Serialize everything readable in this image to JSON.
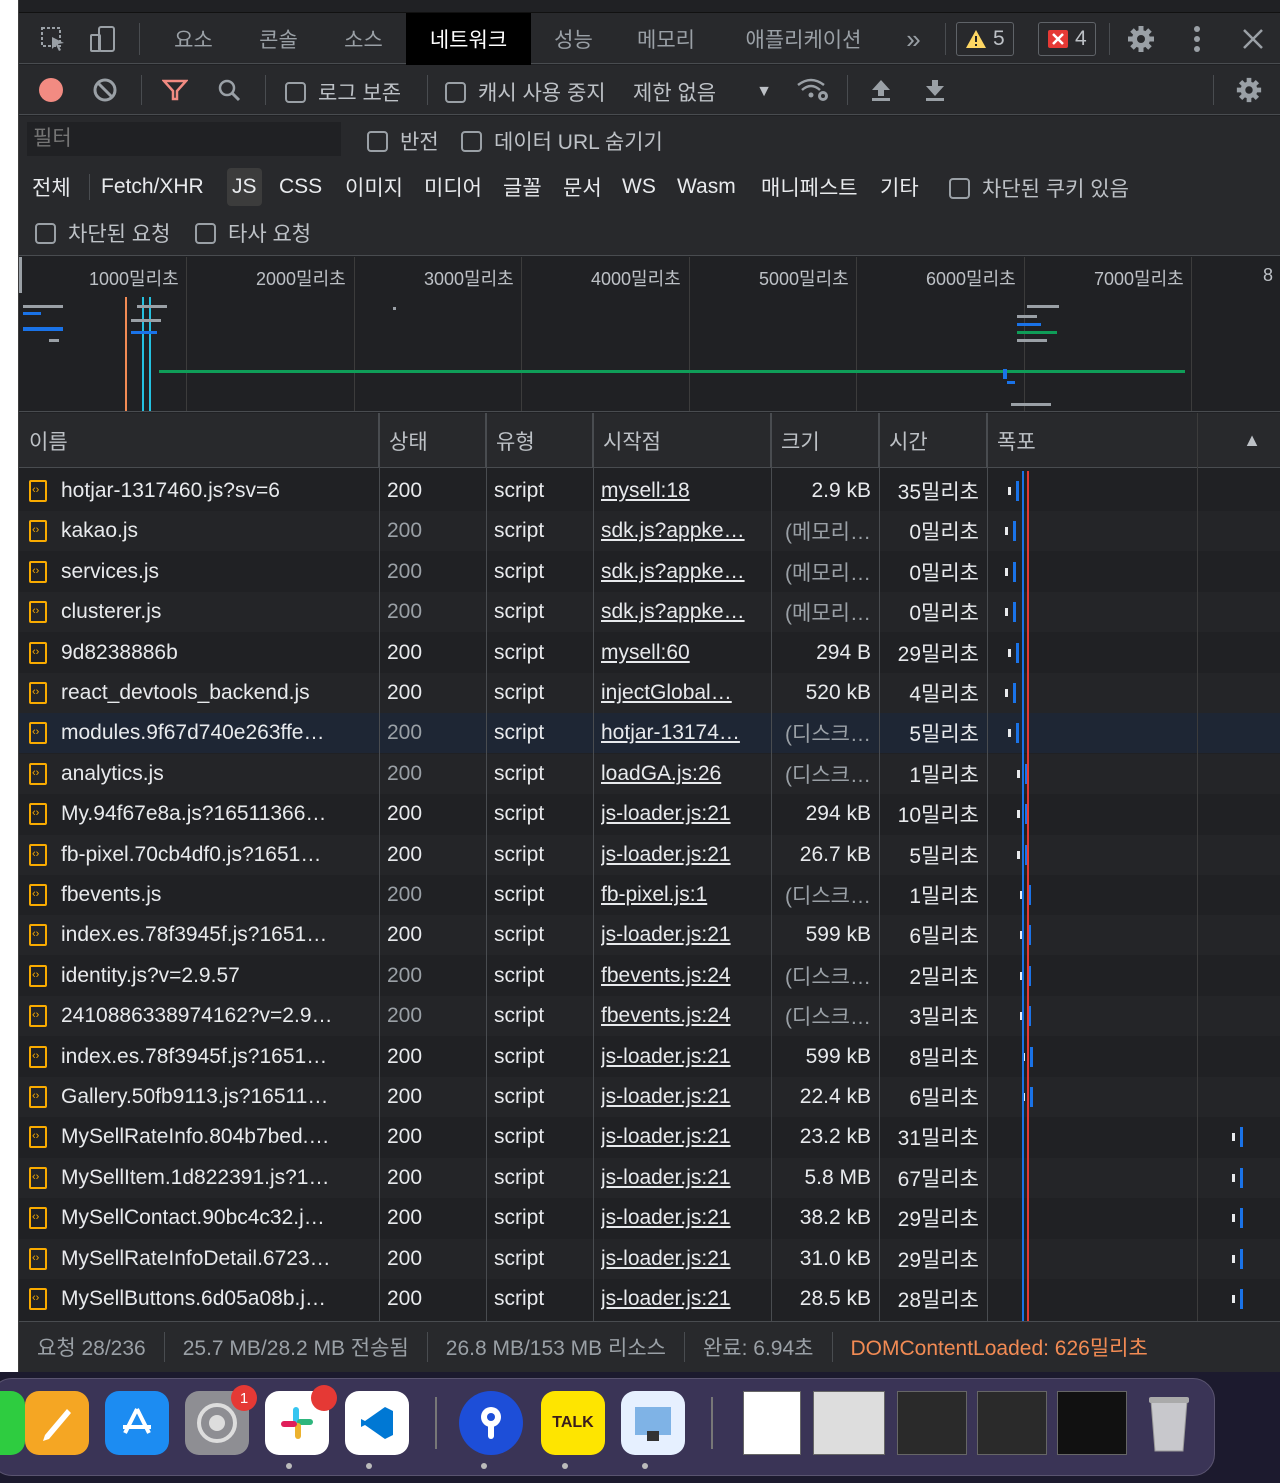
{
  "tabs": {
    "items": [
      "요소",
      "콘솔",
      "소스",
      "네트워크",
      "성능",
      "메모리",
      "애플리케이션"
    ],
    "active": "네트워크",
    "more": "»",
    "warnings": "5",
    "errors": "4"
  },
  "toolbar": {
    "preserve_log": "로그 보존",
    "disable_cache": "캐시 사용 중지",
    "throttling": "제한 없음"
  },
  "filter": {
    "placeholder": "필터",
    "invert": "반전",
    "hide_data_urls": "데이터 URL 숨기기",
    "types": [
      "전체",
      "Fetch/XHR",
      "JS",
      "CSS",
      "이미지",
      "미디어",
      "글꼴",
      "문서",
      "WS",
      "Wasm",
      "매니페스트",
      "기타"
    ],
    "active_type": "JS",
    "blocked_cookies": "차단된 쿠키 있음",
    "blocked_requests": "차단된 요청",
    "third_party": "타사 요청"
  },
  "overview": {
    "ticks": [
      "1000밀리초",
      "2000밀리초",
      "3000밀리초",
      "4000밀리초",
      "5000밀리초",
      "6000밀리초",
      "7000밀리초",
      "8"
    ]
  },
  "columns": [
    "이름",
    "상태",
    "유형",
    "시작점",
    "크기",
    "시간",
    "폭포"
  ],
  "sort_icon": "▲",
  "rows": [
    {
      "name": "hotjar-1317460.js?sv=6",
      "status": "200",
      "type": "script",
      "initiator": "mysell:18",
      "size": "2.9 kB",
      "time": "35밀리초",
      "wf": 0.1,
      "dim": false
    },
    {
      "name": "kakao.js",
      "status": "200",
      "type": "script",
      "initiator": "sdk.js?appke…",
      "size": "(메모리…",
      "time": "0밀리초",
      "wf": 0.09,
      "dim": true
    },
    {
      "name": "services.js",
      "status": "200",
      "type": "script",
      "initiator": "sdk.js?appke…",
      "size": "(메모리…",
      "time": "0밀리초",
      "wf": 0.09,
      "dim": true
    },
    {
      "name": "clusterer.js",
      "status": "200",
      "type": "script",
      "initiator": "sdk.js?appke…",
      "size": "(메모리…",
      "time": "0밀리초",
      "wf": 0.09,
      "dim": true
    },
    {
      "name": "9d8238886b",
      "status": "200",
      "type": "script",
      "initiator": "mysell:60",
      "size": "294 B",
      "time": "29밀리초",
      "wf": 0.1,
      "dim": false
    },
    {
      "name": "react_devtools_backend.js",
      "status": "200",
      "type": "script",
      "initiator": "injectGlobal…",
      "size": "520 kB",
      "time": "4밀리초",
      "wf": 0.09,
      "dim": false
    },
    {
      "name": "modules.9f67d740e263ffe…",
      "status": "200",
      "type": "script",
      "initiator": "hotjar-13174…",
      "size": "(디스크…",
      "time": "5밀리초",
      "wf": 0.1,
      "dim": true
    },
    {
      "name": "analytics.js",
      "status": "200",
      "type": "script",
      "initiator": "loadGA.js:26",
      "size": "(디스크…",
      "time": "1밀리초",
      "wf": 0.13,
      "dim": true
    },
    {
      "name": "My.94f67e8a.js?16511366…",
      "status": "200",
      "type": "script",
      "initiator": "js-loader.js:21",
      "size": "294 kB",
      "time": "10밀리초",
      "wf": 0.13,
      "dim": false
    },
    {
      "name": "fb-pixel.70cb4df0.js?1651…",
      "status": "200",
      "type": "script",
      "initiator": "js-loader.js:21",
      "size": "26.7 kB",
      "time": "5밀리초",
      "wf": 0.13,
      "dim": false
    },
    {
      "name": "fbevents.js",
      "status": "200",
      "type": "script",
      "initiator": "fb-pixel.js:1",
      "size": "(디스크…",
      "time": "1밀리초",
      "wf": 0.14,
      "dim": true
    },
    {
      "name": "index.es.78f3945f.js?1651…",
      "status": "200",
      "type": "script",
      "initiator": "js-loader.js:21",
      "size": "599 kB",
      "time": "6밀리초",
      "wf": 0.14,
      "dim": false
    },
    {
      "name": "identity.js?v=2.9.57",
      "status": "200",
      "type": "script",
      "initiator": "fbevents.js:24",
      "size": "(디스크…",
      "time": "2밀리초",
      "wf": 0.14,
      "dim": true
    },
    {
      "name": "2410886338974162?v=2.9…",
      "status": "200",
      "type": "script",
      "initiator": "fbevents.js:24",
      "size": "(디스크…",
      "time": "3밀리초",
      "wf": 0.14,
      "dim": true
    },
    {
      "name": "index.es.78f3945f.js?1651…",
      "status": "200",
      "type": "script",
      "initiator": "js-loader.js:21",
      "size": "599 kB",
      "time": "8밀리초",
      "wf": 0.145,
      "dim": false
    },
    {
      "name": "Gallery.50fb9113.js?16511…",
      "status": "200",
      "type": "script",
      "initiator": "js-loader.js:21",
      "size": "22.4 kB",
      "time": "6밀리초",
      "wf": 0.145,
      "dim": false
    },
    {
      "name": "MySellRateInfo.804b7bed.…",
      "status": "200",
      "type": "script",
      "initiator": "js-loader.js:21",
      "size": "23.2 kB",
      "time": "31밀리초",
      "wf": 0.86,
      "dim": false
    },
    {
      "name": "MySellItem.1d822391.js?1…",
      "status": "200",
      "type": "script",
      "initiator": "js-loader.js:21",
      "size": "5.8 MB",
      "time": "67밀리초",
      "wf": 0.86,
      "dim": false
    },
    {
      "name": "MySellContact.90bc4c32.j…",
      "status": "200",
      "type": "script",
      "initiator": "js-loader.js:21",
      "size": "38.2 kB",
      "time": "29밀리초",
      "wf": 0.86,
      "dim": false
    },
    {
      "name": "MySellRateInfoDetail.6723…",
      "status": "200",
      "type": "script",
      "initiator": "js-loader.js:21",
      "size": "31.0 kB",
      "time": "29밀리초",
      "wf": 0.86,
      "dim": false
    },
    {
      "name": "MySellButtons.6d05a08b.j…",
      "status": "200",
      "type": "script",
      "initiator": "js-loader.js:21",
      "size": "28.5 kB",
      "time": "28밀리초",
      "wf": 0.86,
      "dim": false
    }
  ],
  "statusbar": {
    "requests": "요청 28/236",
    "transferred": "25.7 MB/28.2 MB 전송됨",
    "resources": "26.8 MB/153 MB 리소스",
    "finish": "완료: 6.94초",
    "dcl": "DOMContentLoaded: 626밀리초"
  },
  "dock": {
    "settings_badge": "1",
    "kakao_label": "TALK"
  },
  "colors": {
    "accent": "#1a73e8",
    "error": "#f28b82",
    "warning": "#fdd663",
    "dcl": "#f28b54"
  }
}
